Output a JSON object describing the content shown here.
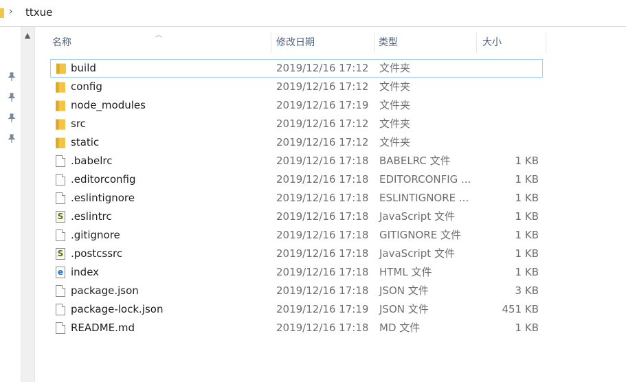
{
  "address": {
    "crumb": "ttxue"
  },
  "columns": {
    "name": "名称",
    "date": "修改日期",
    "type": "类型",
    "size": "大小"
  },
  "colors": {
    "folder": "#f4c545",
    "folder_dark": "#dca928",
    "selection_border": "#99d1ff",
    "header_text": "#4c607a"
  },
  "files": [
    {
      "icon": "folder-icon",
      "name": "build",
      "date": "2019/12/16 17:12",
      "type": "文件夹",
      "size": ""
    },
    {
      "icon": "folder-icon",
      "name": "config",
      "date": "2019/12/16 17:12",
      "type": "文件夹",
      "size": ""
    },
    {
      "icon": "folder-icon",
      "name": "node_modules",
      "date": "2019/12/16 17:19",
      "type": "文件夹",
      "size": ""
    },
    {
      "icon": "folder-icon",
      "name": "src",
      "date": "2019/12/16 17:12",
      "type": "文件夹",
      "size": ""
    },
    {
      "icon": "folder-icon",
      "name": "static",
      "date": "2019/12/16 17:12",
      "type": "文件夹",
      "size": ""
    },
    {
      "icon": "file-icon",
      "name": ".babelrc",
      "date": "2019/12/16 17:18",
      "type": "BABELRC 文件",
      "size": "1 KB"
    },
    {
      "icon": "file-icon",
      "name": ".editorconfig",
      "date": "2019/12/16 17:18",
      "type": "EDITORCONFIG ...",
      "size": "1 KB"
    },
    {
      "icon": "file-icon",
      "name": ".eslintignore",
      "date": "2019/12/16 17:18",
      "type": "ESLINTIGNORE ...",
      "size": "1 KB"
    },
    {
      "icon": "javascript-file-icon",
      "name": ".eslintrc",
      "date": "2019/12/16 17:18",
      "type": "JavaScript 文件",
      "size": "1 KB"
    },
    {
      "icon": "file-icon",
      "name": ".gitignore",
      "date": "2019/12/16 17:18",
      "type": "GITIGNORE 文件",
      "size": "1 KB"
    },
    {
      "icon": "javascript-file-icon",
      "name": ".postcssrc",
      "date": "2019/12/16 17:18",
      "type": "JavaScript 文件",
      "size": "1 KB"
    },
    {
      "icon": "html-file-icon",
      "name": "index",
      "date": "2019/12/16 17:18",
      "type": "HTML 文件",
      "size": "1 KB"
    },
    {
      "icon": "file-icon",
      "name": "package.json",
      "date": "2019/12/16 17:18",
      "type": "JSON 文件",
      "size": "3 KB"
    },
    {
      "icon": "file-icon",
      "name": "package-lock.json",
      "date": "2019/12/16 17:19",
      "type": "JSON 文件",
      "size": "451 KB"
    },
    {
      "icon": "file-icon",
      "name": "README.md",
      "date": "2019/12/16 17:18",
      "type": "MD 文件",
      "size": "1 KB"
    }
  ],
  "selected_index": 0
}
